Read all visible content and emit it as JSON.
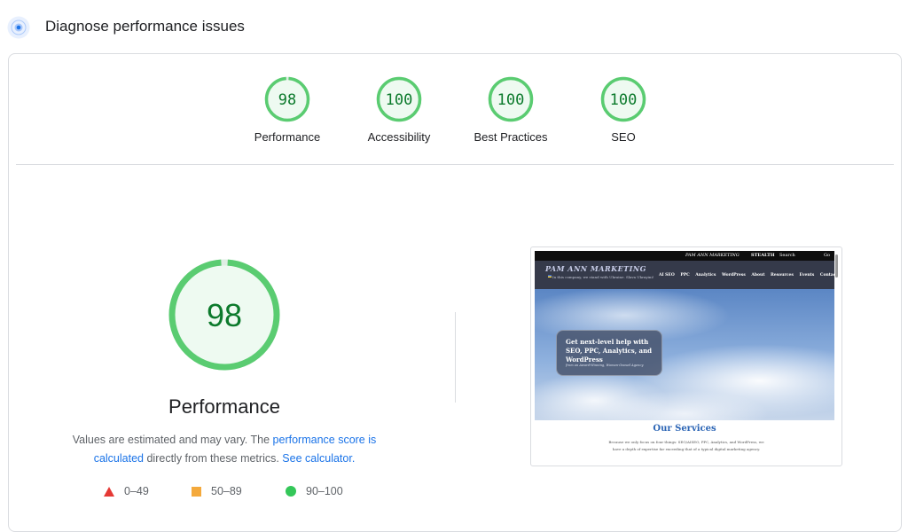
{
  "header": {
    "title": "Diagnose performance issues",
    "icon": "lighthouse-icon"
  },
  "categories": [
    {
      "label": "Performance",
      "score": "98",
      "value": 98
    },
    {
      "label": "Accessibility",
      "score": "100",
      "value": 100
    },
    {
      "label": "Best Practices",
      "score": "100",
      "value": 100
    },
    {
      "label": "SEO",
      "score": "100",
      "value": 100
    }
  ],
  "main": {
    "score": "98",
    "value": 98,
    "title": "Performance",
    "desc_prefix": "Values are estimated and may vary. The ",
    "link_score": "performance score is calculated",
    "desc_middle": " directly from these metrics. ",
    "link_calc": "See calculator."
  },
  "legend": [
    {
      "range": "0–49",
      "shape": "triangle",
      "color": "#e53935"
    },
    {
      "range": "50–89",
      "shape": "square",
      "color": "#f4a93c"
    },
    {
      "range": "90–100",
      "shape": "circle",
      "color": "#34c759"
    }
  ],
  "colors": {
    "pass": "#0cce6b",
    "pass_text": "#0c7a2c",
    "pass_fill": "#eefaf1",
    "link": "#1a73e8"
  },
  "screenshot": {
    "topbar": {
      "a": "PAM ANN MARKETING",
      "b": "STEALTH",
      "c": "Search",
      "d": "Go"
    },
    "brand": "PAM ANN MARKETING",
    "tagline": "In this company, we stand with Ukraine. Slava Ukrayini!",
    "menu": [
      "AI SEO",
      "PPC",
      "Analytics",
      "WordPress",
      "About",
      "Resources",
      "Events",
      "Contact"
    ],
    "hero_heading": "Get next-level help with SEO, PPC, Analytics, and WordPress",
    "hero_sub": "from an Award-Winning, Woman-Owned Agency",
    "services_heading": "Our Services",
    "services_text": "Because we only focus on four things: SEO/AISEO, PPC, Analytics, and WordPress, we have a depth of expertise far exceeding that of a typical digital marketing agency."
  }
}
